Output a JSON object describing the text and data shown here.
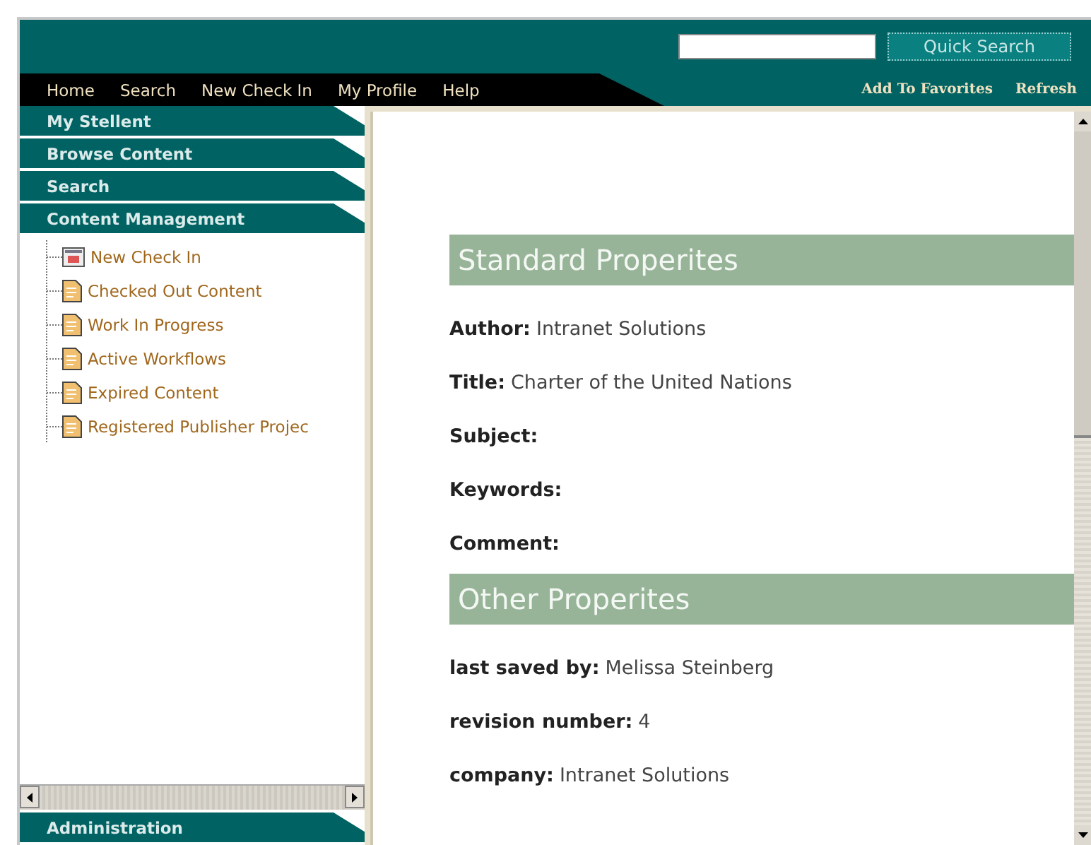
{
  "quick_search": {
    "button": "Quick Search"
  },
  "nav": {
    "items": [
      "Home",
      "Search",
      "New Check In",
      "My Profile",
      "Help"
    ],
    "links": [
      "Add To Favorites",
      "Refresh"
    ]
  },
  "sidebar": {
    "sections": [
      {
        "label": "My Stellent"
      },
      {
        "label": "Browse Content"
      },
      {
        "label": "Search"
      },
      {
        "label": "Content Management",
        "children": [
          {
            "label": "New Check In",
            "kind": "form"
          },
          {
            "label": "Checked Out Content",
            "kind": "page"
          },
          {
            "label": "Work In Progress",
            "kind": "page"
          },
          {
            "label": "Active Workflows",
            "kind": "page"
          },
          {
            "label": "Expired Content",
            "kind": "page"
          },
          {
            "label": "Registered Publisher Projec",
            "kind": "page"
          }
        ]
      }
    ],
    "bottom_section": {
      "label": "Administration"
    }
  },
  "content": {
    "sections": [
      {
        "title": "Standard Properites",
        "fields": [
          {
            "label": "Author:",
            "value": "Intranet Solutions"
          },
          {
            "label": "Title:",
            "value": "Charter of the United Nations"
          },
          {
            "label": "Subject:"
          },
          {
            "label": "Keywords:"
          },
          {
            "label": "Comment:"
          }
        ]
      },
      {
        "title": "Other Properites",
        "fields": [
          {
            "label": "last saved by:",
            "value": "Melissa Steinberg"
          },
          {
            "label": "revision number:",
            "value": "4"
          },
          {
            "label": "company:",
            "value": "Intranet Solutions"
          }
        ]
      }
    ]
  }
}
